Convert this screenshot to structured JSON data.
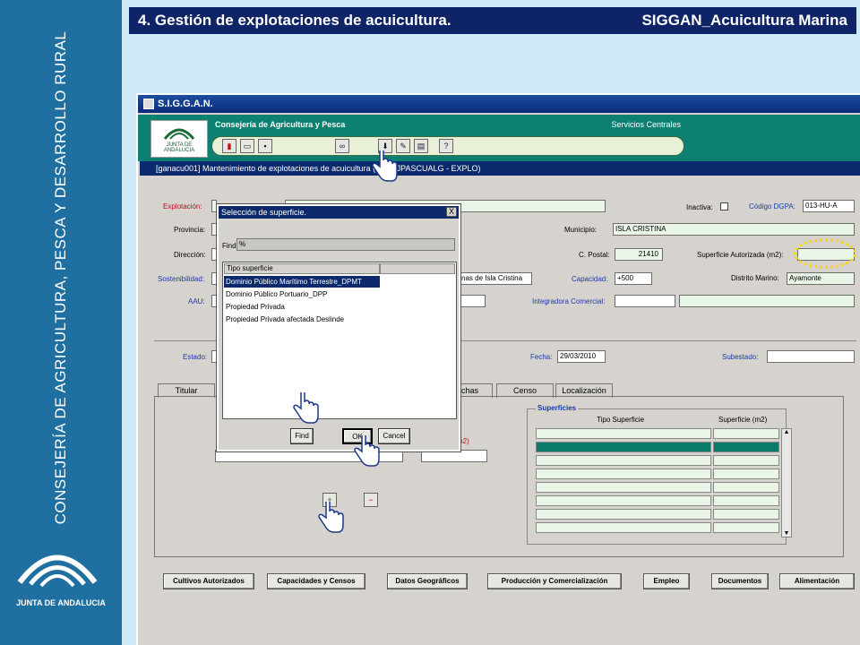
{
  "slide": {
    "title_left": "4. Gestión de explotaciones de acuicultura.",
    "title_right": "SIGGAN_Acuicultura Marina",
    "sidebar_text": "CONSEJERÍA DE AGRICULTURA, PESCA Y DESARROLLO RURAL",
    "logo_text": "JUNTA DE ANDALUCIA"
  },
  "app": {
    "window_title": "S.I.G.G.A.N.",
    "org_name": "Consejería de Agricultura y Pesca",
    "service": "Servicios Centrales",
    "logo_text": "JUNTA DE ANDALUCIA",
    "form_title": "[ganacu001] Mantenimiento de explotaciones de acuicultura (DAP_JPASCUALG - EXPLO)",
    "toolbar": [
      "exit-icon",
      "folder-icon",
      "save-icon",
      "binoculars-icon",
      "download-icon",
      "edit-icon",
      "print-icon",
      "help-icon"
    ]
  },
  "form": {
    "explotacion_label": "Explotación:",
    "inactiva_label": "Inactiva:",
    "codigo_dgpa_label": "Código DGPA:",
    "codigo_dgpa_value": "013-HU-A",
    "provincia_label": "Provincia:",
    "municipio_label": "Municipio:",
    "municipio_value": "ISLA CRISTINA",
    "direccion_label": "Dirección:",
    "cpostal_label": "C. Postal:",
    "cpostal_value": "21410",
    "sup_autorizada_label": "Superficie Autorizada (m2):",
    "sostenibilidad_label": "Sostenibilidad:",
    "sostenibilidad_partial": "nas de Isla Cristina",
    "capacidad_label": "Capacidad:",
    "capacidad_value": "+500",
    "distrito_label": "Distrito Marino:",
    "distrito_value": "Ayamonte",
    "aau_label": "AAU:",
    "integradora_label": "Integradora Comercial:",
    "estado_label": "Estado:",
    "fecha_label": "Fecha:",
    "fecha_value": "29/03/2010",
    "subestado_label": "Subestado:"
  },
  "tabs": [
    "Titular",
    "echas",
    "Censo",
    "Localización"
  ],
  "superficies": {
    "title": "Superficies",
    "col1": "Tipo Superficie",
    "col2": "Superficie (m2)",
    "partial_label": "m2)"
  },
  "bottom_buttons": [
    "Cultivos Autorizados",
    "Capacidades y Censos",
    "Datos Geográficos",
    "Producción y Comercialización",
    "Empleo",
    "Documentos",
    "Alimentación"
  ],
  "dialog": {
    "title": "Selección de superficie.",
    "find_label": "Find",
    "find_value": "%",
    "column_header": "Tipo superficie",
    "items": [
      "Dominio Público Marítimo Terrestre_DPMT",
      "Dominio Público Portuario_DPP",
      "Propiedad Privada",
      "Propiedad Privada afectada Deslinde"
    ],
    "btn_find": "Find",
    "btn_ok": "OK",
    "btn_cancel": "Cancel",
    "close": "X"
  }
}
